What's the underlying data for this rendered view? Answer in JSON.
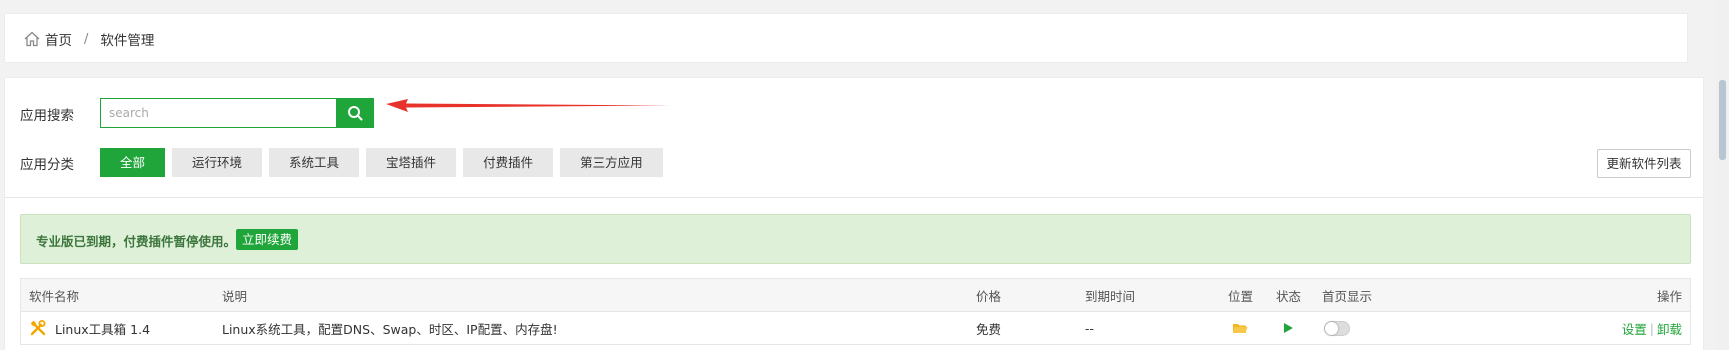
{
  "breadcrumb": {
    "home_icon": "home-icon",
    "home_label": "首页",
    "separator": "/",
    "current_label": "软件管理"
  },
  "search": {
    "label": "应用搜索",
    "placeholder": "search",
    "value": "",
    "button_icon": "search-icon"
  },
  "categories": {
    "label": "应用分类",
    "items": [
      {
        "label": "全部",
        "active": true
      },
      {
        "label": "运行环境",
        "active": false
      },
      {
        "label": "系统工具",
        "active": false
      },
      {
        "label": "宝塔插件",
        "active": false
      },
      {
        "label": "付费插件",
        "active": false
      },
      {
        "label": "第三方应用",
        "active": false
      }
    ]
  },
  "refresh_button_label": "更新软件列表",
  "alert": {
    "text": "专业版已到期，付费插件暂停使用。",
    "button_label": "立即续费"
  },
  "table": {
    "headers": {
      "name": "软件名称",
      "desc": "说明",
      "price": "价格",
      "expire": "到期时间",
      "position": "位置",
      "status": "状态",
      "home_display": "首页显示",
      "ops": "操作"
    },
    "rows": [
      {
        "icon": "tools-icon",
        "name": "Linux工具箱 1.4",
        "desc": "Linux系统工具，配置DNS、Swap、时区、IP配置、内存盘!",
        "price": "免费",
        "expire": "--",
        "position_icon": "folder-icon",
        "status_icon": "play-icon",
        "home_display": false,
        "op_settings": "设置",
        "op_separator": "|",
        "op_uninstall": "卸载"
      }
    ]
  },
  "colors": {
    "accent": "#20a53a",
    "alert_bg": "#dff0d8",
    "alert_text": "#3c763d",
    "arrow": "#e8322c"
  }
}
